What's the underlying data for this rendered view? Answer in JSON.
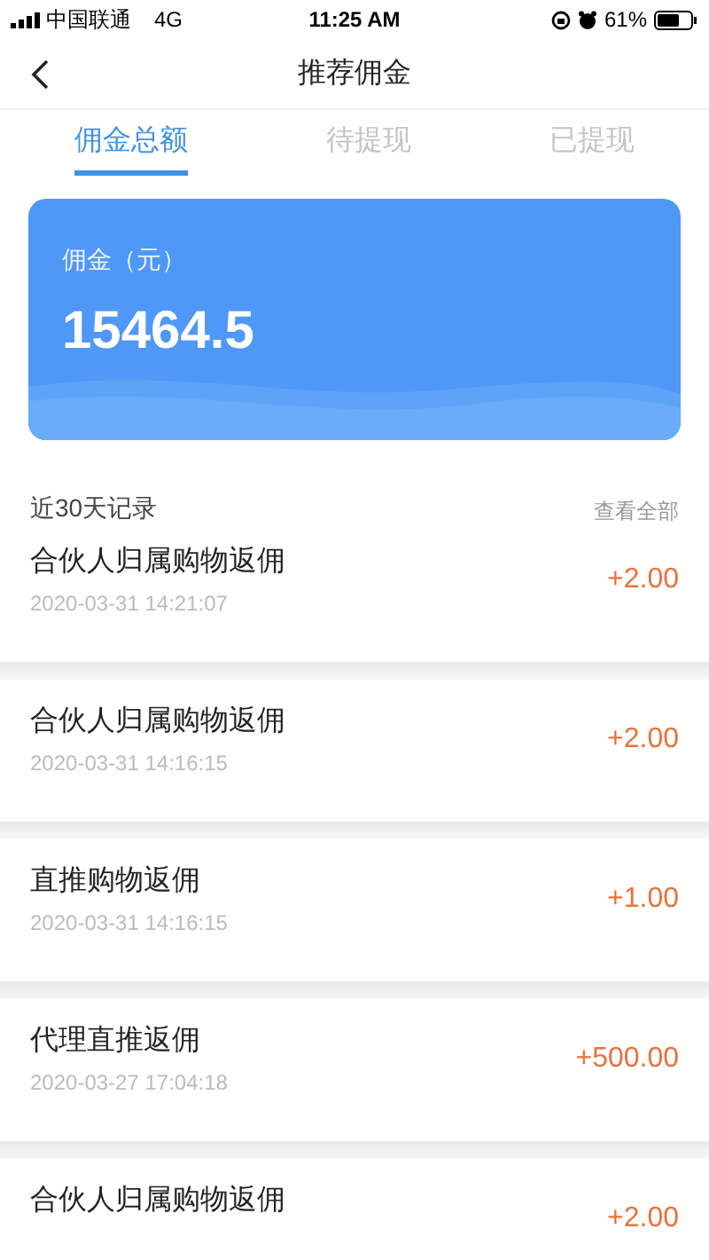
{
  "status_bar": {
    "carrier": "中国联通",
    "network": "4G",
    "time": "11:25 AM",
    "battery": "61%"
  },
  "nav": {
    "title": "推荐佣金"
  },
  "tabs": [
    {
      "label": "佣金总额",
      "selected": true
    },
    {
      "label": "待提现",
      "selected": false
    },
    {
      "label": "已提现",
      "selected": false
    }
  ],
  "summary": {
    "label": "佣金（元）",
    "amount": "15464.5"
  },
  "records": {
    "title": "近30天记录",
    "view_all": "查看全部",
    "items": [
      {
        "title": "合伙人归属购物返佣",
        "time": "2020-03-31 14:21:07",
        "amount": "+2.00"
      },
      {
        "title": "合伙人归属购物返佣",
        "time": "2020-03-31 14:16:15",
        "amount": "+2.00"
      },
      {
        "title": "直推购物返佣",
        "time": "2020-03-31 14:16:15",
        "amount": "+1.00"
      },
      {
        "title": "代理直推返佣",
        "time": "2020-03-27 17:04:18",
        "amount": "+500.00"
      },
      {
        "title": "合伙人归属购物返佣",
        "amount": "+2.00"
      }
    ]
  }
}
